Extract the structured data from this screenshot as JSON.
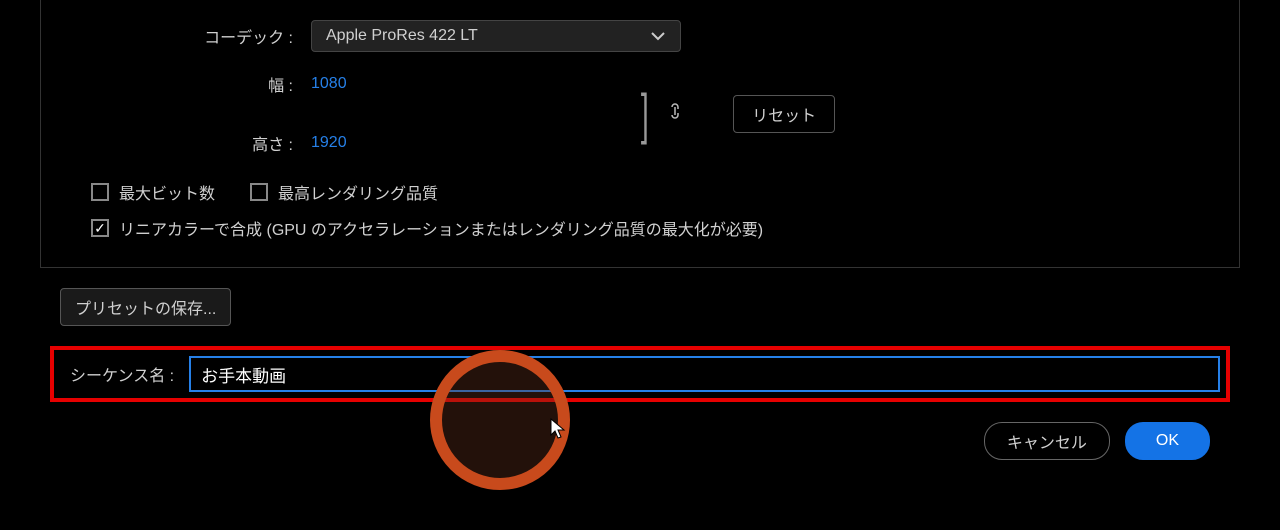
{
  "settings": {
    "codec_label": "コーデック :",
    "codec_value": "Apple ProRes 422 LT",
    "width_label": "幅 :",
    "width_value": "1080",
    "height_label": "高さ :",
    "height_value": "1920",
    "reset_label": "リセット",
    "max_bit_label": "最大ビット数",
    "max_render_label": "最高レンダリング品質",
    "linear_color_label": "リニアカラーで合成 (GPU のアクセラレーションまたはレンダリング品質の最大化が必要)"
  },
  "preset": {
    "save_label": "プリセットの保存..."
  },
  "sequence": {
    "label": "シーケンス名 :",
    "value": "お手本動画"
  },
  "footer": {
    "cancel": "キャンセル",
    "ok": "OK"
  }
}
